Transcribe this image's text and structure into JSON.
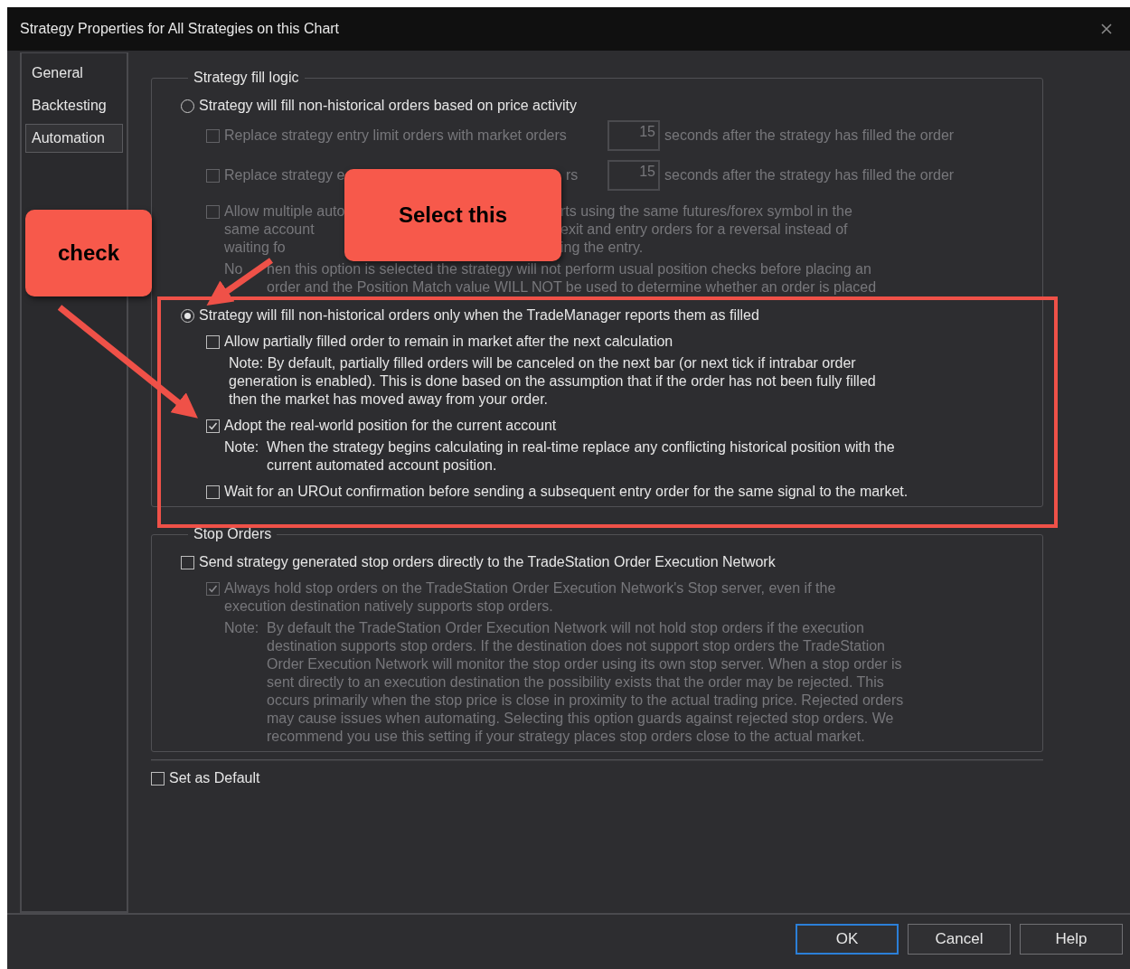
{
  "window": {
    "title": "Strategy Properties for All Strategies on this Chart"
  },
  "tabs": [
    {
      "label": "General",
      "selected": false
    },
    {
      "label": "Backtesting",
      "selected": false
    },
    {
      "label": "Automation",
      "selected": true
    }
  ],
  "fill_logic": {
    "title": "Strategy fill logic",
    "items": [
      {
        "kind": "radio",
        "selected": false,
        "disabled": false,
        "lines": [
          [
            "Strategy will fill non-historical orders based on price activity"
          ]
        ],
        "children": [
          {
            "kind": "delay",
            "checked": false,
            "disabled": true,
            "label": [
              "Replace strategy entry limit orders with market orders"
            ],
            "value": "15",
            "suffix": "seconds after the strategy has filled the order"
          },
          {
            "kind": "delay",
            "checked": false,
            "disabled": true,
            "label": [
              "Replace strategy e",
              "rs"
            ],
            "value": "15",
            "suffix": "seconds after the strategy has filled the order"
          },
          {
            "kind": "check",
            "checked": false,
            "disabled": true,
            "lines": [
              [
                "Allow multiple auto",
                "rts using the same futures/forex symbol in the"
              ],
              [
                "same account",
                "exit and entry orders for a reversal instead of"
              ],
              [
                "waiting fo",
                "ing the entry."
              ]
            ]
          },
          {
            "kind": "note",
            "disabled": true,
            "label": "No",
            "lines": [
              "hen this option is selected the strategy will not perform usual position checks before placing an",
              "order and the Position Match value WILL NOT be used to determine whether an order is placed"
            ]
          }
        ]
      },
      {
        "kind": "radio",
        "selected": true,
        "disabled": false,
        "lines": [
          [
            "Strategy will fill non-historical orders only when the TradeManager reports them as filled"
          ]
        ],
        "children": [
          {
            "kind": "check",
            "checked": false,
            "disabled": false,
            "lines": [
              [
                "Allow partially filled order to remain in market after the next calculation"
              ]
            ]
          },
          {
            "kind": "text",
            "disabled": false,
            "lines": [
              "Note: By default, partially filled orders will be canceled on the next bar (or next tick if intrabar order",
              "generation is enabled).  This is done based on the assumption that if the order has not been fully filled",
              "then the market has moved away from your order."
            ]
          },
          {
            "kind": "check",
            "checked": true,
            "disabled": false,
            "lines": [
              [
                "Adopt the real-world position for the current account"
              ]
            ]
          },
          {
            "kind": "note",
            "disabled": false,
            "label": "Note:",
            "lines": [
              "When the strategy begins calculating in real-time replace any conflicting historical position with the",
              "current automated account position."
            ]
          },
          {
            "kind": "check",
            "checked": false,
            "disabled": false,
            "lines": [
              [
                "Wait for an UROut confirmation before sending a subsequent entry order for the same signal to the market."
              ]
            ]
          }
        ]
      }
    ]
  },
  "stop_orders": {
    "title": "Stop Orders",
    "items": [
      {
        "kind": "check",
        "checked": false,
        "disabled": false,
        "lines": [
          [
            "Send strategy generated stop orders directly to the TradeStation Order Execution Network"
          ]
        ],
        "children": [
          {
            "kind": "check",
            "checked": true,
            "disabled": true,
            "lines": [
              [
                "Always hold stop orders on the TradeStation Order Execution Network's Stop server, even if the"
              ],
              [
                "execution destination natively supports stop orders."
              ]
            ]
          },
          {
            "kind": "note",
            "disabled": true,
            "label": "Note:",
            "lines": [
              "By default the TradeStation Order Execution Network will not hold stop orders if the execution",
              "destination supports stop orders.  If the destination does not support stop orders the TradeStation",
              "Order Execution Network will monitor the stop order using its own stop server.  When a stop order is",
              "sent directly to an execution destination the possibility exists that the order may be rejected.  This",
              "occurs primarily when the stop price is close in proximity to the actual trading price.  Rejected orders",
              "may cause issues when automating.  Selecting this option guards against rejected stop orders.  We",
              "recommend you use this setting if your strategy places stop orders close to the actual market."
            ]
          }
        ]
      }
    ]
  },
  "set_as_default": {
    "label": "Set as Default",
    "checked": false
  },
  "buttons": [
    {
      "label": "OK",
      "selected": true
    },
    {
      "label": "Cancel",
      "selected": false
    },
    {
      "label": "Help",
      "selected": false
    }
  ],
  "annotations": [
    {
      "kind": "callout",
      "text": "check"
    },
    {
      "kind": "callout",
      "text": "Select this"
    }
  ]
}
